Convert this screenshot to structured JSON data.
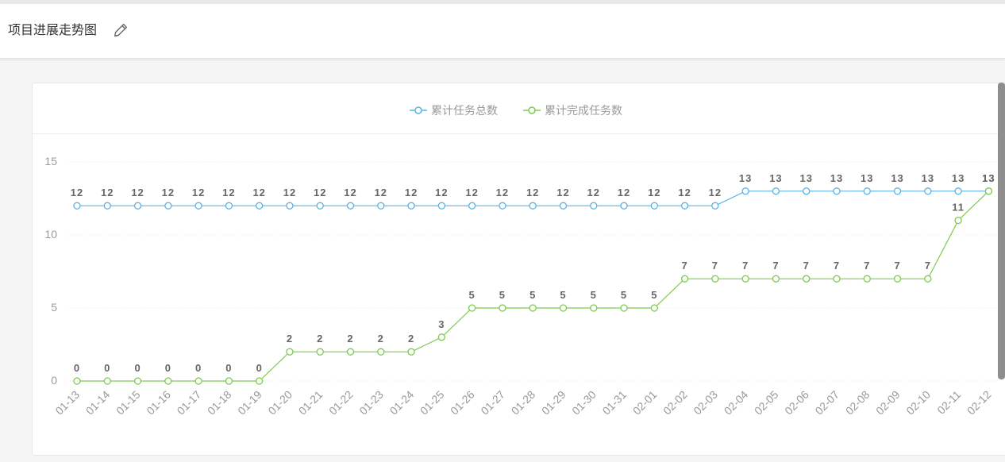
{
  "header": {
    "title": "项目进展走势图"
  },
  "colors": {
    "total": "#5bb3e6",
    "done": "#7dcb4f",
    "grid": "#e8e8e8",
    "axisText": "#999999",
    "labelText": "#666666"
  },
  "chart_data": {
    "type": "line",
    "categories": [
      "01-13",
      "01-14",
      "01-15",
      "01-16",
      "01-17",
      "01-18",
      "01-19",
      "01-20",
      "01-21",
      "01-22",
      "01-23",
      "01-24",
      "01-25",
      "01-26",
      "01-27",
      "01-28",
      "01-29",
      "01-30",
      "01-31",
      "02-01",
      "02-02",
      "02-03",
      "02-04",
      "02-05",
      "02-06",
      "02-07",
      "02-08",
      "02-09",
      "02-10",
      "02-11",
      "02-12"
    ],
    "series": [
      {
        "name": "累计任务总数",
        "color": "#5bb3e6",
        "values": [
          12,
          12,
          12,
          12,
          12,
          12,
          12,
          12,
          12,
          12,
          12,
          12,
          12,
          12,
          12,
          12,
          12,
          12,
          12,
          12,
          12,
          12,
          13,
          13,
          13,
          13,
          13,
          13,
          13,
          13,
          13
        ]
      },
      {
        "name": "累计完成任务数",
        "color": "#7dcb4f",
        "values": [
          0,
          0,
          0,
          0,
          0,
          0,
          0,
          2,
          2,
          2,
          2,
          2,
          3,
          5,
          5,
          5,
          5,
          5,
          5,
          5,
          7,
          7,
          7,
          7,
          7,
          7,
          7,
          7,
          7,
          11,
          13
        ]
      }
    ],
    "yticks": [
      0,
      5,
      10,
      15
    ],
    "ylim": [
      0,
      15
    ],
    "legend": "top-center",
    "grid": true
  }
}
